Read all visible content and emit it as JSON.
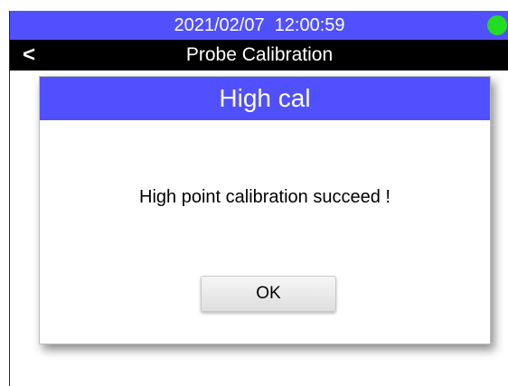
{
  "status_bar": {
    "datetime": "2021/02/07  12:00:59",
    "indicator_color": "#22dd22",
    "background_color": "#5050ff"
  },
  "title_bar": {
    "back_label": "<",
    "title": "Probe Calibration"
  },
  "dialog": {
    "title": "High cal",
    "message": "High point calibration succeed !",
    "ok_label": "OK"
  }
}
